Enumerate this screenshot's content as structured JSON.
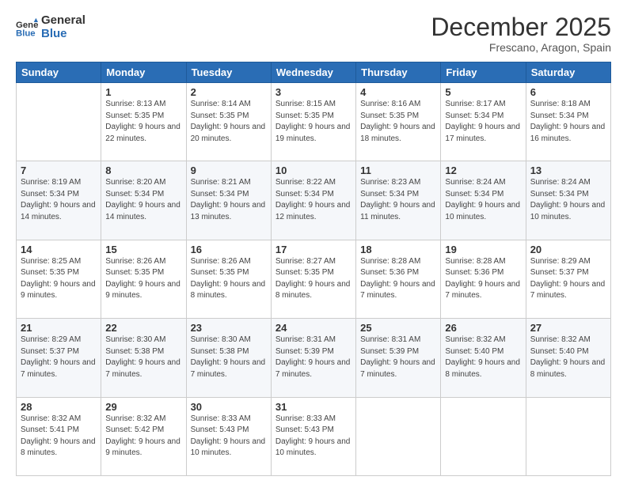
{
  "logo": {
    "line1": "General",
    "line2": "Blue"
  },
  "header": {
    "month": "December 2025",
    "location": "Frescano, Aragon, Spain"
  },
  "weekdays": [
    "Sunday",
    "Monday",
    "Tuesday",
    "Wednesday",
    "Thursday",
    "Friday",
    "Saturday"
  ],
  "weeks": [
    [
      {
        "day": null
      },
      {
        "day": 1,
        "sunrise": "8:13 AM",
        "sunset": "5:35 PM",
        "daylight": "9 hours and 22 minutes."
      },
      {
        "day": 2,
        "sunrise": "8:14 AM",
        "sunset": "5:35 PM",
        "daylight": "9 hours and 20 minutes."
      },
      {
        "day": 3,
        "sunrise": "8:15 AM",
        "sunset": "5:35 PM",
        "daylight": "9 hours and 19 minutes."
      },
      {
        "day": 4,
        "sunrise": "8:16 AM",
        "sunset": "5:35 PM",
        "daylight": "9 hours and 18 minutes."
      },
      {
        "day": 5,
        "sunrise": "8:17 AM",
        "sunset": "5:34 PM",
        "daylight": "9 hours and 17 minutes."
      },
      {
        "day": 6,
        "sunrise": "8:18 AM",
        "sunset": "5:34 PM",
        "daylight": "9 hours and 16 minutes."
      }
    ],
    [
      {
        "day": 7,
        "sunrise": "8:19 AM",
        "sunset": "5:34 PM",
        "daylight": "9 hours and 14 minutes."
      },
      {
        "day": 8,
        "sunrise": "8:20 AM",
        "sunset": "5:34 PM",
        "daylight": "9 hours and 14 minutes."
      },
      {
        "day": 9,
        "sunrise": "8:21 AM",
        "sunset": "5:34 PM",
        "daylight": "9 hours and 13 minutes."
      },
      {
        "day": 10,
        "sunrise": "8:22 AM",
        "sunset": "5:34 PM",
        "daylight": "9 hours and 12 minutes."
      },
      {
        "day": 11,
        "sunrise": "8:23 AM",
        "sunset": "5:34 PM",
        "daylight": "9 hours and 11 minutes."
      },
      {
        "day": 12,
        "sunrise": "8:24 AM",
        "sunset": "5:34 PM",
        "daylight": "9 hours and 10 minutes."
      },
      {
        "day": 13,
        "sunrise": "8:24 AM",
        "sunset": "5:34 PM",
        "daylight": "9 hours and 10 minutes."
      }
    ],
    [
      {
        "day": 14,
        "sunrise": "8:25 AM",
        "sunset": "5:35 PM",
        "daylight": "9 hours and 9 minutes."
      },
      {
        "day": 15,
        "sunrise": "8:26 AM",
        "sunset": "5:35 PM",
        "daylight": "9 hours and 9 minutes."
      },
      {
        "day": 16,
        "sunrise": "8:26 AM",
        "sunset": "5:35 PM",
        "daylight": "9 hours and 8 minutes."
      },
      {
        "day": 17,
        "sunrise": "8:27 AM",
        "sunset": "5:35 PM",
        "daylight": "9 hours and 8 minutes."
      },
      {
        "day": 18,
        "sunrise": "8:28 AM",
        "sunset": "5:36 PM",
        "daylight": "9 hours and 7 minutes."
      },
      {
        "day": 19,
        "sunrise": "8:28 AM",
        "sunset": "5:36 PM",
        "daylight": "9 hours and 7 minutes."
      },
      {
        "day": 20,
        "sunrise": "8:29 AM",
        "sunset": "5:37 PM",
        "daylight": "9 hours and 7 minutes."
      }
    ],
    [
      {
        "day": 21,
        "sunrise": "8:29 AM",
        "sunset": "5:37 PM",
        "daylight": "9 hours and 7 minutes."
      },
      {
        "day": 22,
        "sunrise": "8:30 AM",
        "sunset": "5:38 PM",
        "daylight": "9 hours and 7 minutes."
      },
      {
        "day": 23,
        "sunrise": "8:30 AM",
        "sunset": "5:38 PM",
        "daylight": "9 hours and 7 minutes."
      },
      {
        "day": 24,
        "sunrise": "8:31 AM",
        "sunset": "5:39 PM",
        "daylight": "9 hours and 7 minutes."
      },
      {
        "day": 25,
        "sunrise": "8:31 AM",
        "sunset": "5:39 PM",
        "daylight": "9 hours and 7 minutes."
      },
      {
        "day": 26,
        "sunrise": "8:32 AM",
        "sunset": "5:40 PM",
        "daylight": "9 hours and 8 minutes."
      },
      {
        "day": 27,
        "sunrise": "8:32 AM",
        "sunset": "5:40 PM",
        "daylight": "9 hours and 8 minutes."
      }
    ],
    [
      {
        "day": 28,
        "sunrise": "8:32 AM",
        "sunset": "5:41 PM",
        "daylight": "9 hours and 8 minutes."
      },
      {
        "day": 29,
        "sunrise": "8:32 AM",
        "sunset": "5:42 PM",
        "daylight": "9 hours and 9 minutes."
      },
      {
        "day": 30,
        "sunrise": "8:33 AM",
        "sunset": "5:43 PM",
        "daylight": "9 hours and 10 minutes."
      },
      {
        "day": 31,
        "sunrise": "8:33 AM",
        "sunset": "5:43 PM",
        "daylight": "9 hours and 10 minutes."
      },
      {
        "day": null
      },
      {
        "day": null
      },
      {
        "day": null
      }
    ]
  ]
}
